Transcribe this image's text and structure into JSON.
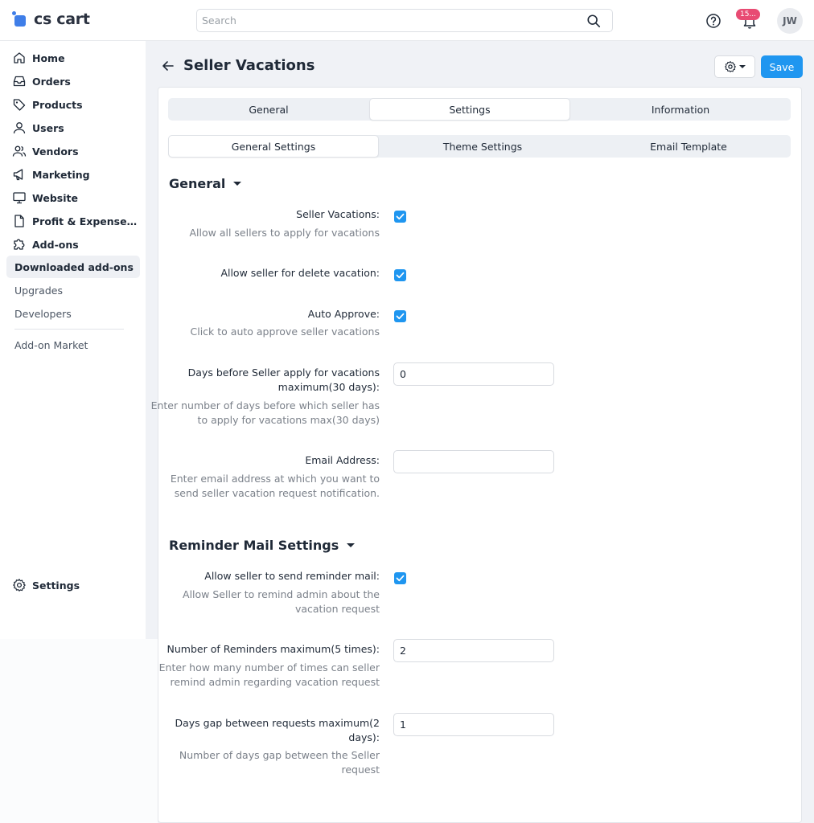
{
  "brand": {
    "name": "cs cart"
  },
  "search": {
    "placeholder": "Search"
  },
  "notifications": {
    "count": "15..."
  },
  "user": {
    "initials": "JW"
  },
  "sidebar": {
    "items": [
      {
        "label": "Home",
        "icon": "home-icon"
      },
      {
        "label": "Orders",
        "icon": "inbox-icon"
      },
      {
        "label": "Products",
        "icon": "tag-icon"
      },
      {
        "label": "Users",
        "icon": "user-icon"
      },
      {
        "label": "Vendors",
        "icon": "users-icon"
      },
      {
        "label": "Marketing",
        "icon": "megaphone-icon"
      },
      {
        "label": "Website",
        "icon": "monitor-icon"
      },
      {
        "label": "Profit & Expense Tra...",
        "icon": "document-icon"
      },
      {
        "label": "Add-ons",
        "icon": "puzzle-icon"
      }
    ],
    "subitems": [
      {
        "label": "Downloaded add-ons",
        "active": true
      },
      {
        "label": "Upgrades"
      },
      {
        "label": "Developers"
      }
    ],
    "market": "Add-on Market",
    "settings": "Settings"
  },
  "header": {
    "title": "Seller Vacations",
    "save_label": "Save"
  },
  "tabs": [
    "General",
    "Settings",
    "Information"
  ],
  "active_tab": "Settings",
  "subtabs": [
    "General Settings",
    "Theme Settings",
    "Email Template"
  ],
  "active_subtab": "General Settings",
  "sections": {
    "general": {
      "title": "General",
      "seller_vacations": {
        "label": "Seller Vacations:",
        "hint": "Allow all sellers to apply for vacations",
        "checked": true
      },
      "allow_delete": {
        "label": "Allow seller for delete vacation:",
        "checked": true
      },
      "auto_approve": {
        "label": "Auto Approve:",
        "hint": "Click to auto approve seller vacations",
        "checked": true
      },
      "days_before": {
        "label_line1": "Days before Seller apply for vacations",
        "label_line2": "maximum(30 days):",
        "hint_line1": "Enter number of days before which seller has",
        "hint_line2": "to apply for vacations max(30 days)",
        "value": "0"
      },
      "email": {
        "label": "Email Address:",
        "hint_line1": "Enter email address at which you want to",
        "hint_line2": "send seller vacation request notification.",
        "value": ""
      }
    },
    "reminder": {
      "title": "Reminder Mail Settings",
      "allow_reminder": {
        "label": "Allow seller to send reminder mail:",
        "hint_line1": "Allow Seller to remind admin about the",
        "hint_line2": "vacation request",
        "checked": true
      },
      "num_reminders": {
        "label": "Number of Reminders maximum(5 times):",
        "hint_line1": "Enter how many number of times can seller",
        "hint_line2": "remind admin regarding vacation request",
        "value": "2"
      },
      "days_gap": {
        "label_line1": "Days gap between requests maximum(2",
        "label_line2": "days):",
        "hint_line1": "Number of days gap between the Seller",
        "hint_line2": "request",
        "value": "1"
      }
    }
  },
  "colors": {
    "accent": "#1f96f0",
    "badge": "#e84b73",
    "logo": "#3f7ee8"
  }
}
